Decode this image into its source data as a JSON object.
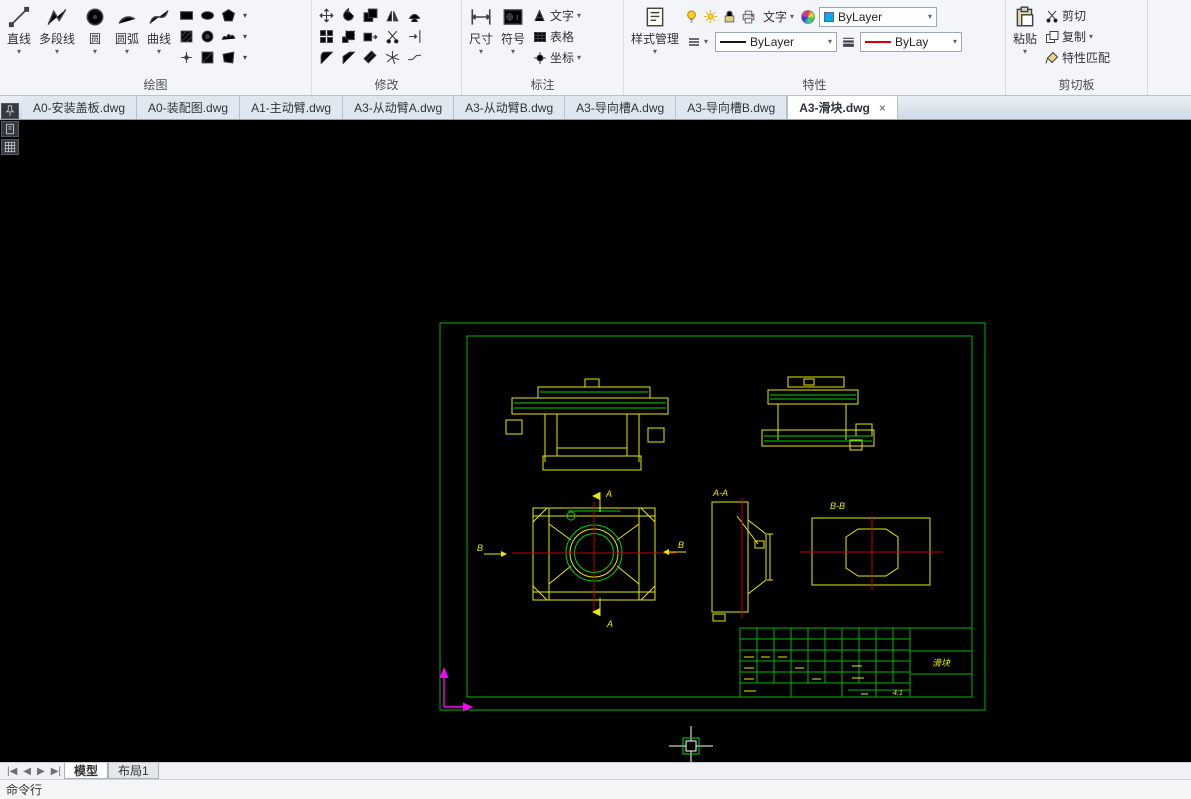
{
  "ui": {
    "close_glyph": "×",
    "caret_glyph": "▾"
  },
  "ribbon": {
    "panels": [
      {
        "label": "绘图"
      },
      {
        "label": "修改"
      },
      {
        "label": "标注"
      },
      {
        "label": "特性"
      },
      {
        "label": "剪切板"
      }
    ],
    "draw": {
      "tools": [
        {
          "label": "直线"
        },
        {
          "label": "多段线"
        },
        {
          "label": "圆"
        },
        {
          "label": "圆弧"
        },
        {
          "label": "曲线"
        }
      ]
    },
    "annotate": {
      "dimension_label": "尺寸",
      "symbol_label": "符号",
      "text_label": "文字",
      "table_label": "表格",
      "coordinate_label": "坐标"
    },
    "properties": {
      "style_manager_label": "样式管理",
      "layer_dropdown_label": "文字",
      "color_value": "ByLayer",
      "linetype_value": "ByLayer",
      "lineweight_value": "ByLay"
    },
    "clipboard": {
      "paste_label": "粘贴",
      "cut_label": "剪切",
      "copy_label": "复制",
      "match_properties_label": "特性匹配"
    }
  },
  "document_tabs": [
    {
      "label": "A0-安装盖板.dwg"
    },
    {
      "label": "A0-装配图.dwg"
    },
    {
      "label": "A1-主动臂.dwg"
    },
    {
      "label": "A3-从动臂A.dwg"
    },
    {
      "label": "A3-从动臂B.dwg"
    },
    {
      "label": "A3-导向槽A.dwg"
    },
    {
      "label": "A3-导向槽B.dwg"
    },
    {
      "label": "A3-滑块.dwg",
      "active": true
    }
  ],
  "drawing": {
    "labels": {
      "section_aa": "A-A",
      "section_bb": "B-B",
      "cut_arrow_a": "A",
      "view_arrow_b": "B",
      "part_name": "滑块",
      "scale": "4:1"
    },
    "colors": {
      "frame": "#00b400",
      "outline": "#e8e800",
      "detail": "#00d400",
      "centerline": "#c40000",
      "hatch": "#ff00ff",
      "ucs": "#ff00ff",
      "crosshair": "#ffffff"
    }
  },
  "side_strip": {
    "icons": [
      "pin",
      "page",
      "grid"
    ]
  },
  "statusbar": {
    "nav": [
      "|◀",
      "◀",
      "▶",
      "▶|"
    ],
    "model_tab": "模型",
    "layout_tab": "布局1"
  },
  "command_line": {
    "label": "命令行"
  }
}
